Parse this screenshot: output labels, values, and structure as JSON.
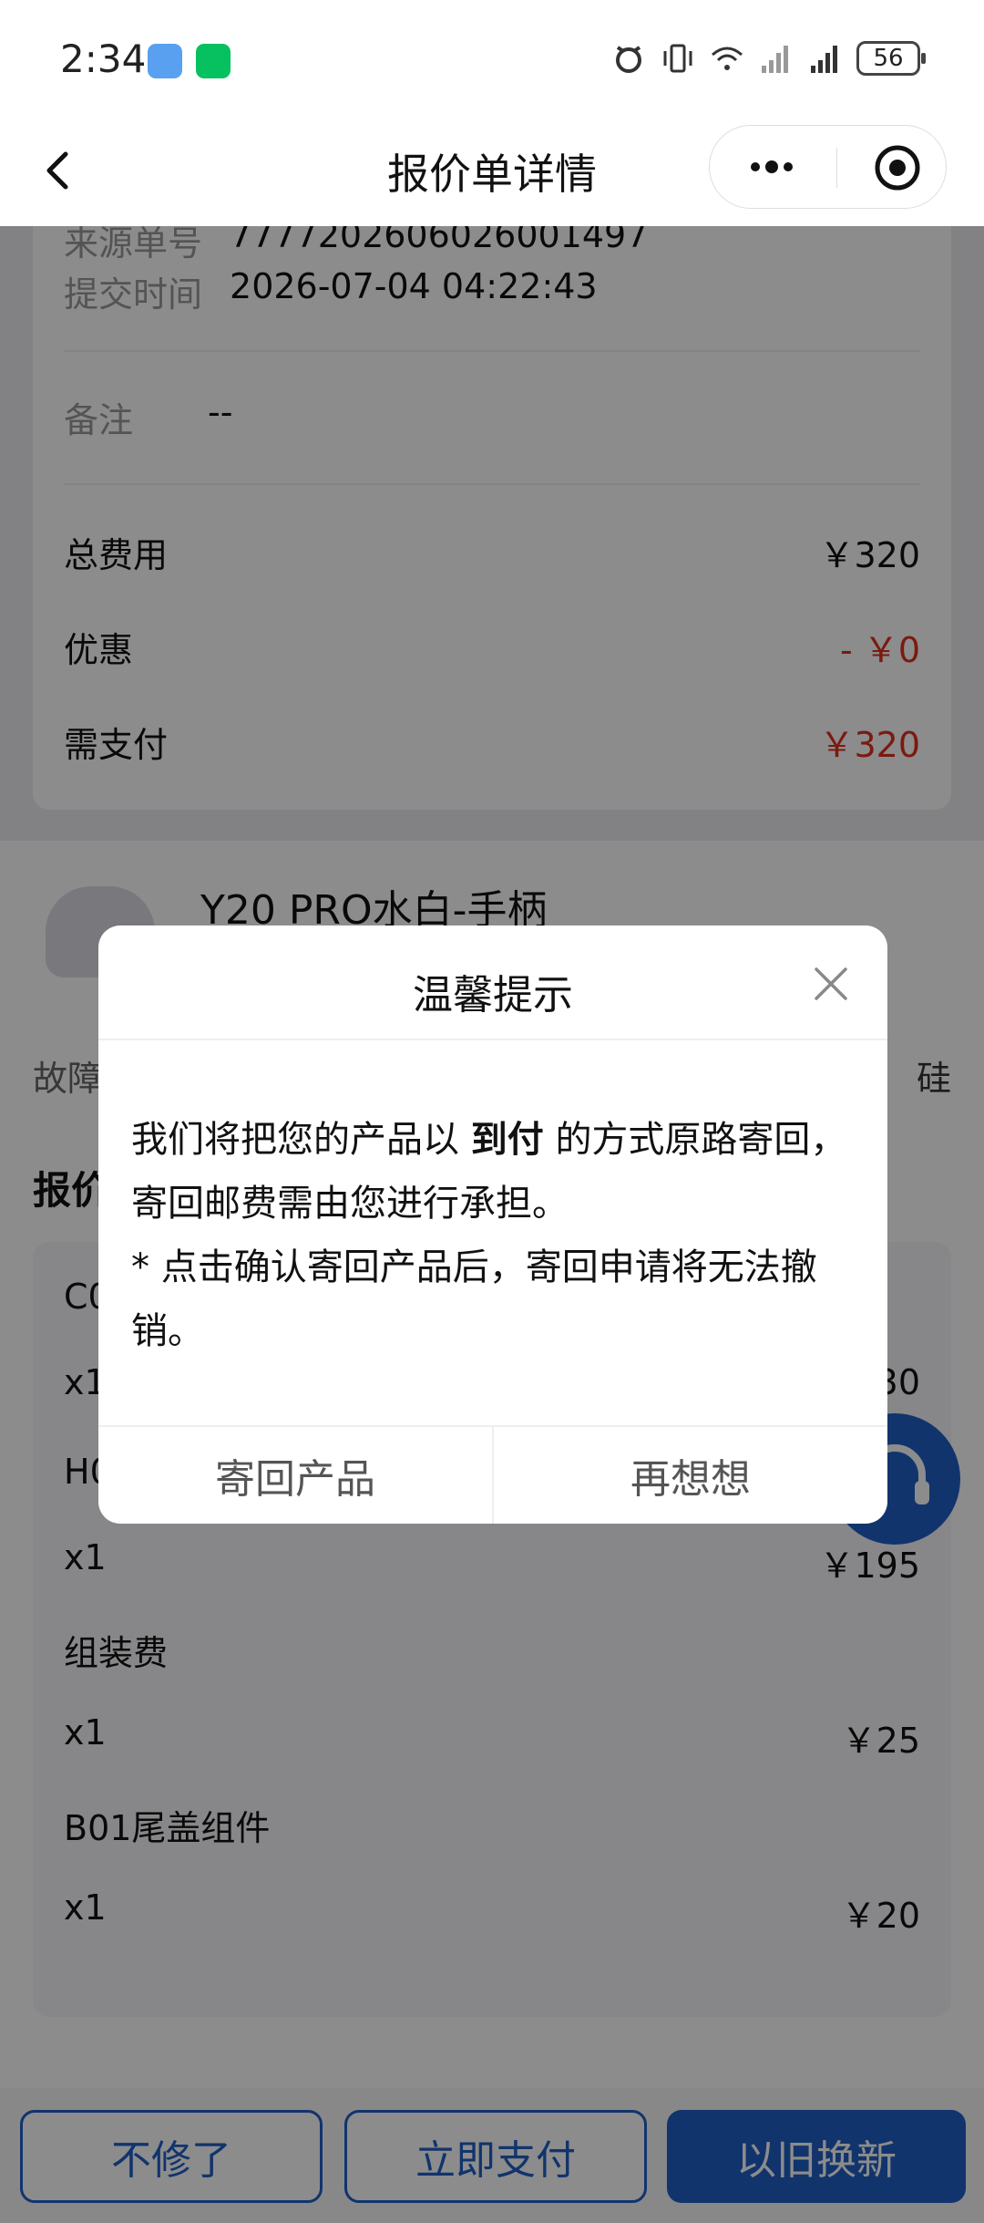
{
  "status_bar": {
    "time": "2:34",
    "battery": "56"
  },
  "nav": {
    "title": "报价单详情"
  },
  "info_card": {
    "source_label": "来源单号",
    "source_value": "7777202606026001497",
    "submit_label": "提交时间",
    "submit_value": "2026-07-04 04:22:43",
    "remark_label": "备注",
    "remark_value": "--",
    "total_label": "总费用",
    "total_value": "￥320",
    "discount_label": "优惠",
    "discount_value": "- ￥0",
    "pay_label": "需支付",
    "pay_value": "￥320"
  },
  "product": {
    "name": "Y20 PRO水白-手柄",
    "fault_label": "故障",
    "fault_value_tail": "硅",
    "quote_title": "报价"
  },
  "quote_items": [
    {
      "name": "C0",
      "qty": "x1",
      "price": "30"
    },
    {
      "name": "H0",
      "qty": "x1",
      "price": "￥195"
    },
    {
      "name": "组装费",
      "qty": "x1",
      "price": "￥25"
    },
    {
      "name": "B01尾盖组件",
      "qty": "x1",
      "price": "￥20"
    }
  ],
  "bottom_buttons": {
    "no_repair": "不修了",
    "pay_now": "立即支付",
    "trade_in": "以旧换新"
  },
  "dialog": {
    "title": "温馨提示",
    "body_part1": "我们将把您的产品以",
    "body_bold": "到付",
    "body_part2": "的方式原路寄回，寄回邮费需由您进行承担。",
    "body_note": "* 点击确认寄回产品后，寄回申请将无法撤销。",
    "confirm": "寄回产品",
    "cancel": "再想想"
  },
  "colors": {
    "accent": "#1f5fc6",
    "red": "#e0301e"
  }
}
